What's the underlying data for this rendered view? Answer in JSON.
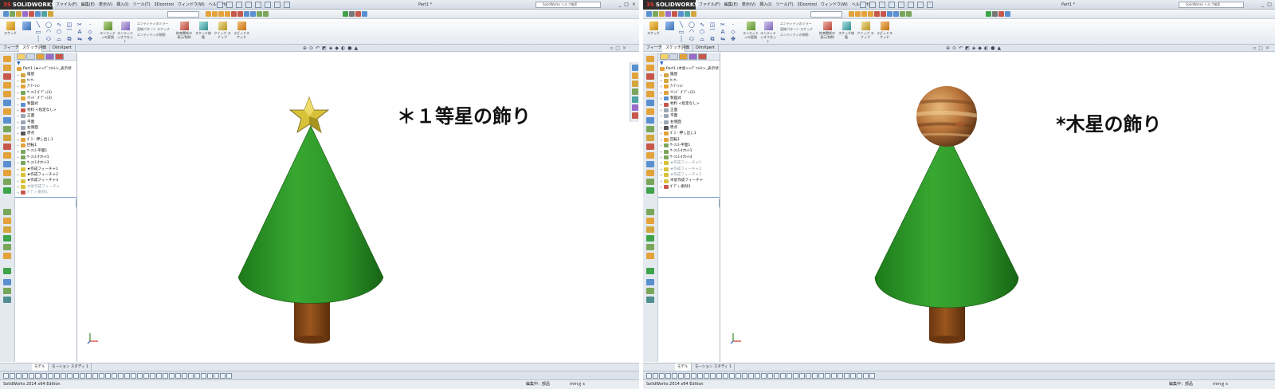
{
  "colors": {
    "tree_green": "#2f9b29",
    "trunk_brown": "#8b4a16",
    "star_gold": "#d8c23a",
    "jupiter_orange": "#b8743a",
    "titlebar_bg": "#d9e0e8"
  },
  "app": {
    "logo_text": "SOLIDWORKS",
    "menu": [
      "ファイル(F)",
      "編集(E)",
      "表示(V)",
      "挿入(I)",
      "ツール(T)",
      "3Dcontrol",
      "ウィンドウ(W)",
      "ヘルプ(H)"
    ],
    "doc_title": "Part1 *",
    "search_placeholder": "SolidWorks ヘルプ検索",
    "window_buttons": [
      "_",
      "□",
      "×"
    ]
  },
  "command_manager": {
    "sketch_label": "スケッチ",
    "exit_sketch_label": "エンティティの変換",
    "entity_offset_label": "エンティティオフセット",
    "mirror_label": "エンティティのミラー",
    "linear_pattern_label": "直線パターン スケッチ",
    "move_entities_label": "エンティティの移動",
    "display_relations_label": "拘束関係の表示/削除",
    "repair_sketch_label": "スケッチ修復",
    "quick_snaps_label": "クイック スナップ",
    "rapid_sketch_label": "ラピッドスケッチ"
  },
  "command_tabs": [
    "フィーチャー",
    "スケッチ",
    "評価",
    "DimXpert"
  ],
  "bottom_tabs": [
    "モデル",
    "モーション スタディ 1"
  ],
  "status_bar": {
    "product": "SolidWorks 2014 x64 Edition",
    "editing": "編集中：部品",
    "units": "ｍｍｇｓ",
    "help": "?"
  },
  "screens": [
    {
      "id": "star",
      "tree_root": "Part1 (★<<ﾃﾞﾌｫﾙﾄ>_表示状",
      "feature_tree": [
        {
          "label": "履歴",
          "icon": "history-icon"
        },
        {
          "label": "ｾﾝｻｰ",
          "icon": "sensor-icon"
        },
        {
          "label": "ｱﾉﾃｰｼｮﾝ",
          "icon": "annotation-icon"
        },
        {
          "label": "ｻｰﾌｪｽ ﾎﾞﾃﾞｨ(3)",
          "icon": "surface-body-icon"
        },
        {
          "label": "ｿﾘｯﾄﾞ ﾎﾞﾃﾞｨ(3)",
          "icon": "solid-body-icon"
        },
        {
          "label": "製図式",
          "icon": "equation-icon"
        },
        {
          "label": "材料 <指定なし>",
          "icon": "material-icon"
        },
        {
          "label": "正面",
          "icon": "plane-icon"
        },
        {
          "label": "平面",
          "icon": "plane-icon"
        },
        {
          "label": "右側面",
          "icon": "plane-icon"
        },
        {
          "label": "原点",
          "icon": "origin-icon"
        },
        {
          "label": "ﾎﾞｽ - 押し出し1",
          "icon": "extrude-icon"
        },
        {
          "label": "回転1",
          "icon": "revolve-icon"
        },
        {
          "label": "ｻｰﾌｪｽ-平面1",
          "icon": "surface-plane-icon"
        },
        {
          "label": "ｻｰﾌｪｽ-ｵﾌｾｯﾄ1",
          "icon": "surface-offset-icon"
        },
        {
          "label": "ｻｰﾌｪｽ-ｵﾌｾｯﾄ3",
          "icon": "surface-offset-icon"
        },
        {
          "label": "★作成フィーチャ1",
          "icon": "feature-icon"
        },
        {
          "label": "★作成フィーチャ2",
          "icon": "feature-icon"
        },
        {
          "label": "★作成フィーチャ3",
          "icon": "feature-icon"
        },
        {
          "label": "木星作成フィーチャ",
          "icon": "feature-icon",
          "dim": true
        },
        {
          "label": "ﾎﾞﾃﾞｨｰ削除1",
          "icon": "body-delete-icon",
          "dim": true
        }
      ],
      "label": "＊１等星の飾り",
      "ornament": "star"
    },
    {
      "id": "jupiter",
      "tree_root": "Part1 (木星<<ﾃﾞﾌｫﾙﾄ>_表示状",
      "feature_tree": [
        {
          "label": "履歴",
          "icon": "history-icon"
        },
        {
          "label": "ｾﾝｻｰ",
          "icon": "sensor-icon"
        },
        {
          "label": "ｱﾉﾃｰｼｮﾝ",
          "icon": "annotation-icon"
        },
        {
          "label": "ｿﾘｯﾄﾞ ﾎﾞﾃﾞｨ(2)",
          "icon": "solid-body-icon"
        },
        {
          "label": "製図式",
          "icon": "equation-icon"
        },
        {
          "label": "材料 <指定なし>",
          "icon": "material-icon"
        },
        {
          "label": "正面",
          "icon": "plane-icon"
        },
        {
          "label": "平面",
          "icon": "plane-icon"
        },
        {
          "label": "右側面",
          "icon": "plane-icon"
        },
        {
          "label": "原点",
          "icon": "origin-icon"
        },
        {
          "label": "ﾎﾞｽ - 押し出し1",
          "icon": "extrude-icon"
        },
        {
          "label": "回転1",
          "icon": "revolve-icon"
        },
        {
          "label": "ｻｰﾌｪｽ-平面1",
          "icon": "surface-plane-icon"
        },
        {
          "label": "ｻｰﾌｪｽ-ｵﾌｾｯﾄ1",
          "icon": "surface-offset-icon"
        },
        {
          "label": "ｻｰﾌｪｽ-ｵﾌｾｯﾄ3",
          "icon": "surface-offset-icon"
        },
        {
          "label": "★作成フィーチャ1",
          "icon": "feature-icon",
          "dim": true
        },
        {
          "label": "★作成フィーチャ2",
          "icon": "feature-icon",
          "dim": true
        },
        {
          "label": "★作成フィーチャ3",
          "icon": "feature-icon",
          "dim": true
        },
        {
          "label": "木星作成フィーチャ",
          "icon": "feature-icon"
        },
        {
          "label": "ﾎﾞﾃﾞｨｰ削除1",
          "icon": "body-delete-icon"
        }
      ],
      "label": "*木星の飾り",
      "ornament": "jupiter"
    }
  ]
}
